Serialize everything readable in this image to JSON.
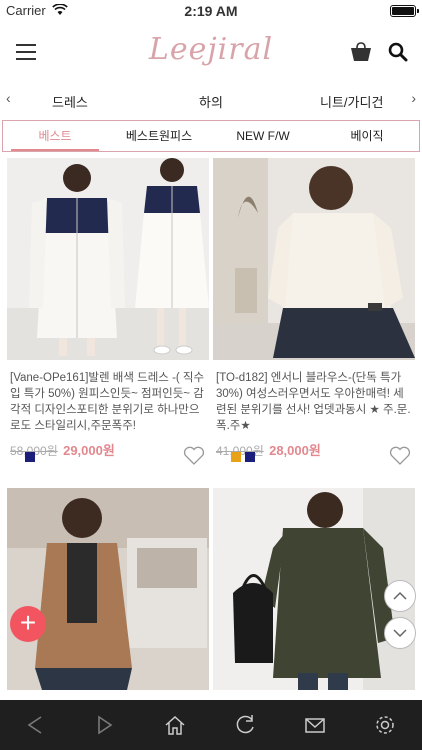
{
  "status_bar": {
    "carrier": "Carrier",
    "time": "2:19 AM"
  },
  "header": {
    "logo": "Leejiral"
  },
  "category_nav": {
    "items": [
      "드레스",
      "하의",
      "니트/가디건"
    ]
  },
  "tabs": [
    {
      "label": "베스트",
      "active": true
    },
    {
      "label": "베스트원피스",
      "active": false
    },
    {
      "label": "NEW F/W",
      "active": false
    },
    {
      "label": "베이직",
      "active": false
    }
  ],
  "products": [
    {
      "title": "[Vane-OPe161]발렌 배색 드레스 -( 직수입 특가 50%) 원피스인듯~ 점퍼인듯~ 감각적 디자인스포티한 분위기로 하나만으로도 스타일리시,주문폭주!",
      "old_price": "58,000원",
      "price": "29,000원",
      "colors": [
        "#1b1f7a"
      ]
    },
    {
      "title": "[TO-d182] 엔서니 블라우스-(단독 특가 30%) 여성스러우면서도 우아한매력! 세련된 분위기를 선사! 업뎃과동시 ★ 주.문.폭.주★",
      "old_price": "41,000원",
      "price": "28,000원",
      "colors": [
        "#e8a21a",
        "#1b1f7a"
      ]
    },
    {
      "title": "",
      "old_price": "",
      "price": "",
      "colors": []
    },
    {
      "title": "",
      "old_price": "",
      "price": "",
      "colors": []
    }
  ],
  "colors": {
    "accent": "#e2888f",
    "tab_border": "#d9a4ab",
    "fab": "#f25560",
    "bottom_bar": "#1f1f1f"
  },
  "icons": [
    "menu-icon",
    "cart-icon",
    "search-icon",
    "heart-icon",
    "back-icon",
    "forward-icon",
    "home-icon",
    "refresh-icon",
    "mail-icon",
    "settings-icon",
    "plus-icon",
    "chevron-up-icon",
    "chevron-down-icon"
  ]
}
